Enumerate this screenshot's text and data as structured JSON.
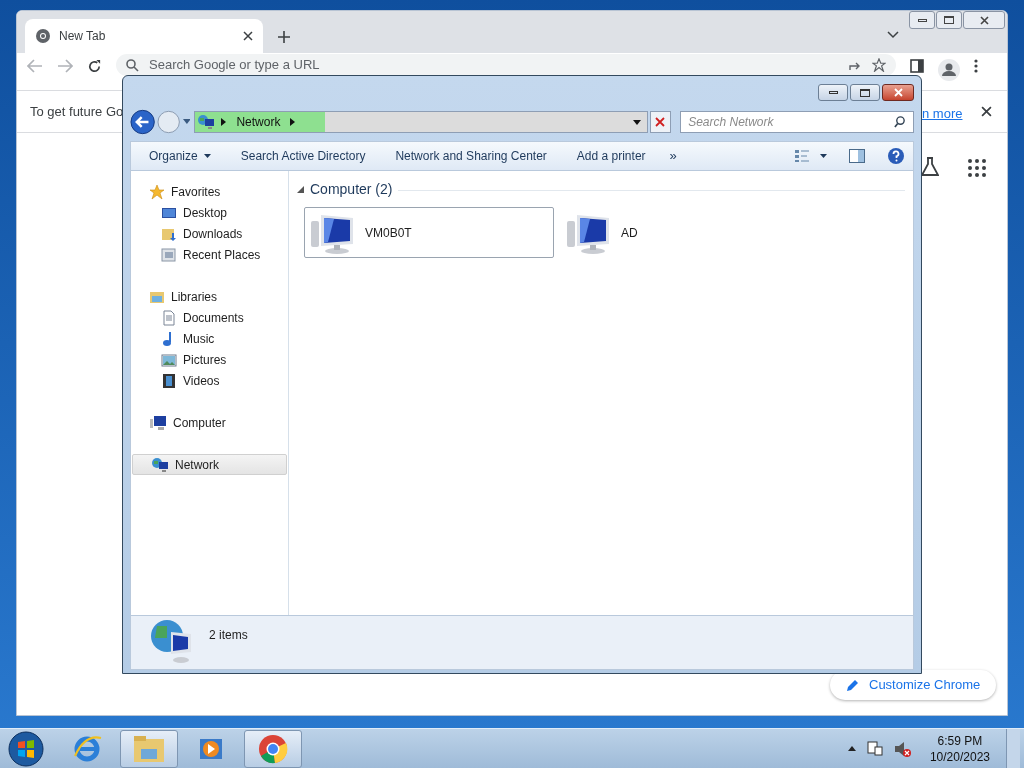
{
  "browser": {
    "tab": {
      "title": "New Tab",
      "selected": true
    },
    "address": {
      "placeholder": "Search Google or type a URL"
    },
    "infobar": {
      "text": "To get future Go",
      "link": "n more"
    },
    "customize": "Customize Chrome"
  },
  "explorer": {
    "breadcrumb": [
      "Network"
    ],
    "search": {
      "placeholder": "Search Network"
    },
    "toolbar": [
      {
        "label": "Organize",
        "dropdown": true
      },
      {
        "label": "Search Active Directory",
        "dropdown": false
      },
      {
        "label": "Network and Sharing Center",
        "dropdown": false
      },
      {
        "label": "Add a printer",
        "dropdown": false
      }
    ],
    "more": "»",
    "sidebar": [
      {
        "label": "Favorites",
        "kind": "star",
        "selected": false,
        "children": [
          {
            "label": "Desktop",
            "kind": "desktop",
            "selected": false
          },
          {
            "label": "Downloads",
            "kind": "download",
            "selected": false
          },
          {
            "label": "Recent Places",
            "kind": "recent",
            "selected": false
          }
        ]
      },
      {
        "label": "Libraries",
        "kind": "library",
        "selected": false,
        "children": [
          {
            "label": "Documents",
            "kind": "document",
            "selected": false
          },
          {
            "label": "Music",
            "kind": "music",
            "selected": false
          },
          {
            "label": "Pictures",
            "kind": "pictures",
            "selected": false
          },
          {
            "label": "Videos",
            "kind": "video",
            "selected": false
          }
        ]
      },
      {
        "label": "Computer",
        "kind": "computer",
        "selected": false
      },
      {
        "label": "Network",
        "kind": "network",
        "selected": true
      }
    ],
    "group": {
      "title": "Computer (2)",
      "expanded": true,
      "items": [
        {
          "name": "VM0B0T",
          "selected": true
        },
        {
          "name": "AD",
          "selected": false
        }
      ]
    },
    "status": "2 items"
  },
  "taskbar": {
    "apps": [
      {
        "kind": "ie",
        "active": false
      },
      {
        "kind": "folder",
        "active": true
      },
      {
        "kind": "media",
        "active": false
      },
      {
        "kind": "chrome",
        "active": true
      }
    ],
    "time": "6:59 PM",
    "date": "10/20/2023"
  }
}
